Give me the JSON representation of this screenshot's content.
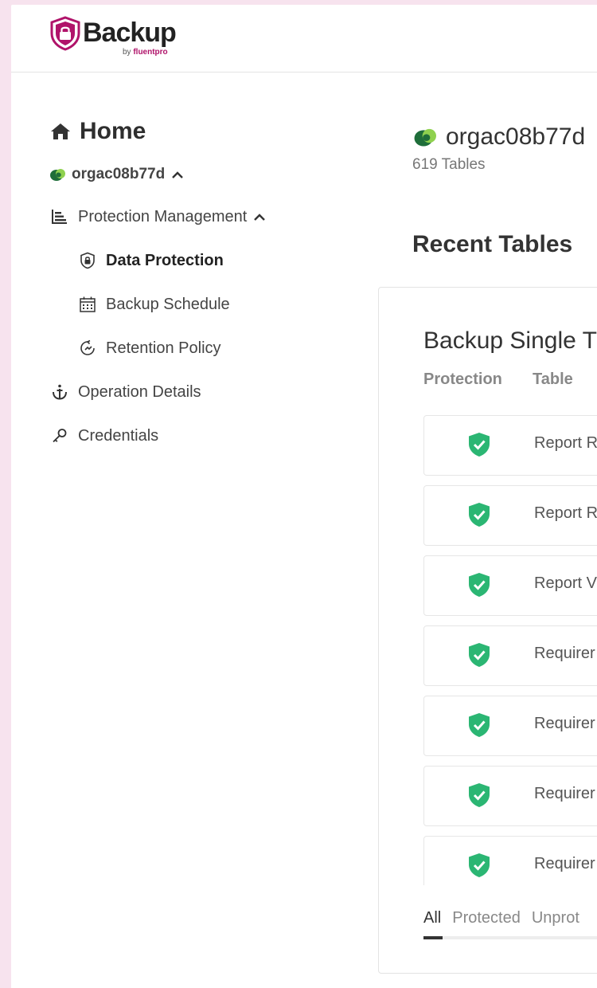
{
  "header": {
    "logo_word": "Backup",
    "logo_by": "by",
    "logo_brand": "fluentpro",
    "brand_color": "#b0136a"
  },
  "sidebar": {
    "home_label": "Home",
    "org_label": "orgac08b77d",
    "items": [
      {
        "label": "Protection Management",
        "icon": "list-chart-icon",
        "level": 1,
        "expanded": true
      },
      {
        "label": "Data Protection",
        "icon": "lock-shield-icon",
        "level": 2,
        "active": true
      },
      {
        "label": "Backup Schedule",
        "icon": "calendar-icon",
        "level": 2
      },
      {
        "label": "Retention Policy",
        "icon": "retention-icon",
        "level": 2
      },
      {
        "label": "Operation Details",
        "icon": "anchor-icon",
        "level": 1
      },
      {
        "label": "Credentials",
        "icon": "key-icon",
        "level": 1
      }
    ]
  },
  "main": {
    "org_title": "orgac08b77d",
    "tables_count": "619 Tables",
    "recent_title": "Recent Tables",
    "card": {
      "title": "Backup Single T",
      "columns": [
        "Protection",
        "Table"
      ],
      "rows": [
        {
          "name": "Report R",
          "status": "protected"
        },
        {
          "name": "Report R",
          "status": "protected"
        },
        {
          "name": "Report V",
          "status": "protected"
        },
        {
          "name": "Requirer",
          "status": "protected"
        },
        {
          "name": "Requirer",
          "status": "protected"
        },
        {
          "name": "Requirer",
          "status": "protected"
        },
        {
          "name": "Requirer",
          "status": "protected"
        }
      ],
      "filters": [
        "All",
        "Protected",
        "Unprot"
      ],
      "selected_filter": "All"
    }
  },
  "colors": {
    "protected_green": "#2bb673",
    "org_icon_dark": "#1f6e3a",
    "org_icon_light": "#8fd14f"
  }
}
